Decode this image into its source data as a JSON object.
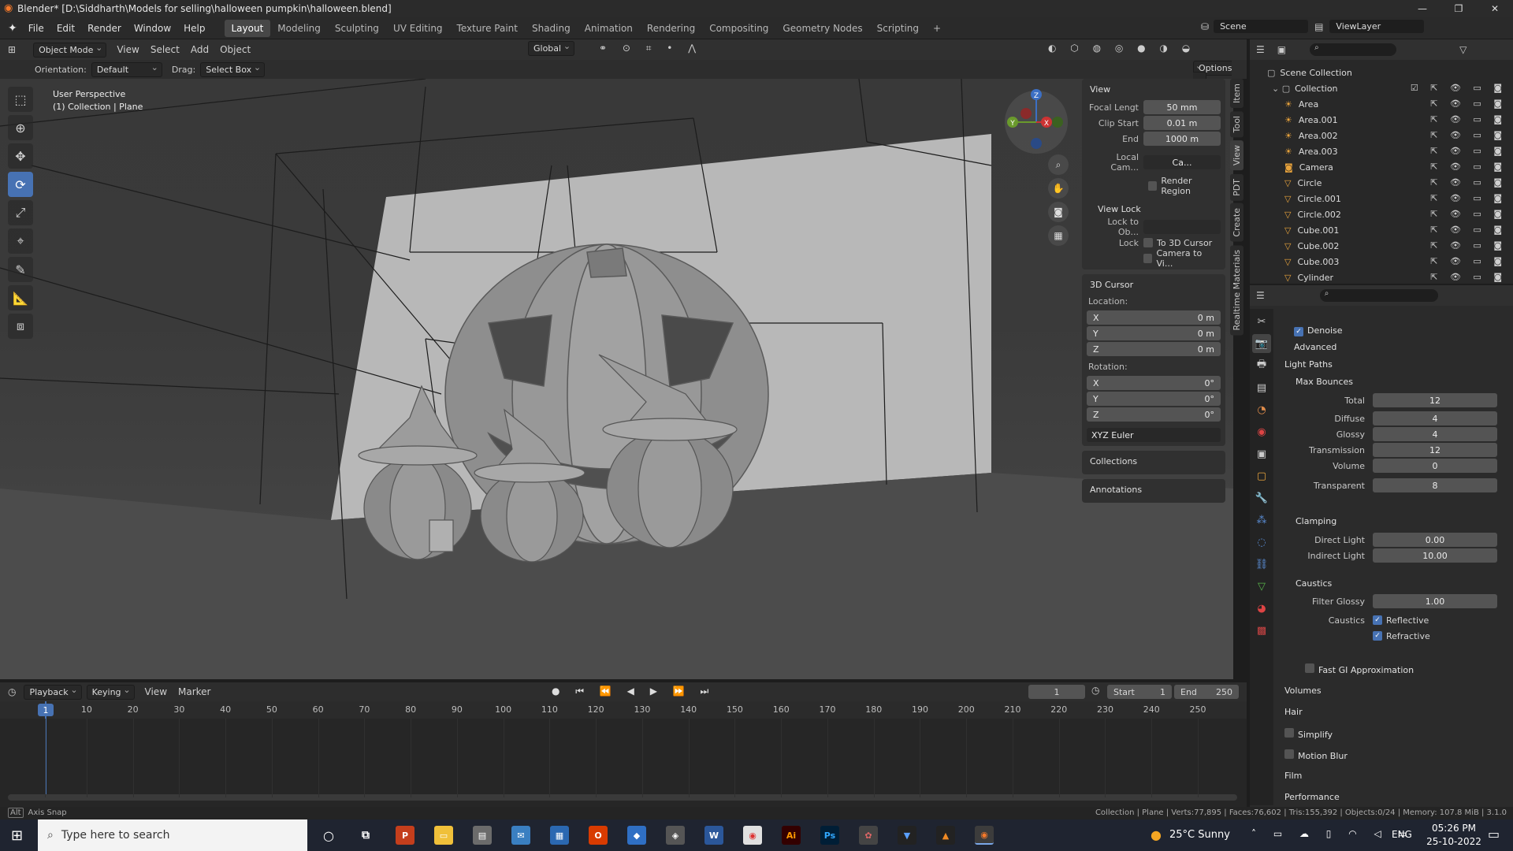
{
  "window": {
    "title": "Blender* [D:\\Siddharth\\Models for selling\\halloween pumpkin\\halloween.blend]",
    "minimize": "—",
    "maximize": "❐",
    "close": "✕"
  },
  "menu": [
    "File",
    "Edit",
    "Render",
    "Window",
    "Help"
  ],
  "workspaces": [
    "Layout",
    "Modeling",
    "Sculpting",
    "UV Editing",
    "Texture Paint",
    "Shading",
    "Animation",
    "Rendering",
    "Compositing",
    "Geometry Nodes",
    "Scripting"
  ],
  "active_workspace": "Layout",
  "scene": {
    "scene_name": "Scene",
    "view_layer": "ViewLayer"
  },
  "viewport_header": {
    "mode": "Object Mode",
    "menus": [
      "View",
      "Select",
      "Add",
      "Object"
    ],
    "transform": "Global",
    "options": "Options"
  },
  "tool_settings": {
    "orientation_label": "Orientation:",
    "orientation_value": "Default",
    "drag_label": "Drag:",
    "drag_value": "Select Box"
  },
  "viewport_info": {
    "line1": "User Perspective",
    "line2": "(1) Collection | Plane"
  },
  "npanel": {
    "view_title": "View",
    "focal_label": "Focal Lengt",
    "focal_value": "50 mm",
    "clip_start_label": "Clip Start",
    "clip_start_value": "0.01 m",
    "end_label": "End",
    "end_value": "1000 m",
    "local_cam_label": "Local Cam...",
    "local_cam_value": "Ca...",
    "render_region": "Render Region",
    "view_lock_title": "View Lock",
    "lock_to_obj_label": "Lock to Ob...",
    "lock_label": "Lock",
    "to_3d_cursor": "To 3D Cursor",
    "camera_to_view": "Camera to Vi...",
    "cursor_title": "3D Cursor",
    "location_label": "Location:",
    "loc_x": "0 m",
    "loc_y": "0 m",
    "loc_z": "0 m",
    "rotation_label": "Rotation:",
    "rot_x": "0°",
    "rot_y": "0°",
    "rot_z": "0°",
    "rot_mode": "XYZ Euler",
    "collections": "Collections",
    "annotations": "Annotations",
    "axis_x": "X",
    "axis_y": "Y",
    "axis_z": "Z",
    "tabs": [
      "Item",
      "Tool",
      "View",
      "PDT",
      "Create",
      "Realtime Materials"
    ]
  },
  "outliner": {
    "root": "Scene Collection",
    "collection": "Collection",
    "items": [
      "Area",
      "Area.001",
      "Area.002",
      "Area.003",
      "Camera",
      "Circle",
      "Circle.001",
      "Circle.002",
      "Cube.001",
      "Cube.002",
      "Cube.003",
      "Cylinder"
    ]
  },
  "properties": {
    "denoise": "Denoise",
    "advanced": "Advanced",
    "light_paths": "Light Paths",
    "max_bounces": "Max Bounces",
    "total_label": "Total",
    "total": "12",
    "diffuse_label": "Diffuse",
    "diffuse": "4",
    "glossy_label": "Glossy",
    "glossy": "4",
    "transmission_label": "Transmission",
    "transmission": "12",
    "volume_label": "Volume",
    "volume": "0",
    "transparent_label": "Transparent",
    "transparent": "8",
    "clamping": "Clamping",
    "direct_label": "Direct Light",
    "direct": "0.00",
    "indirect_label": "Indirect Light",
    "indirect": "10.00",
    "caustics": "Caustics",
    "filter_glossy_label": "Filter Glossy",
    "filter_glossy": "1.00",
    "caustics_label": "Caustics",
    "reflective": "Reflective",
    "refractive": "Refractive",
    "fast_gi": "Fast GI Approximation",
    "volumes": "Volumes",
    "hair": "Hair",
    "simplify": "Simplify",
    "motion_blur": "Motion Blur",
    "film": "Film",
    "performance": "Performance"
  },
  "timeline": {
    "menus": [
      "Playback",
      "Keying",
      "View",
      "Marker"
    ],
    "current_frame": "1",
    "start_label": "Start",
    "start": "1",
    "end_label": "End",
    "end": "250",
    "ruler": [
      "1",
      "10",
      "20",
      "30",
      "40",
      "50",
      "60",
      "70",
      "80",
      "90",
      "100",
      "110",
      "120",
      "130",
      "140",
      "150",
      "160",
      "170",
      "180",
      "190",
      "200",
      "210",
      "220",
      "230",
      "240",
      "250"
    ]
  },
  "status": {
    "left": "Axis Snap",
    "right": "Collection | Plane | Verts:77,895 | Faces:76,602 | Tris:155,392 | Objects:0/24 | Memory: 107.8 MiB | 3.1.0"
  },
  "taskbar": {
    "search_placeholder": "Type here to search",
    "weather": "25°C  Sunny",
    "lang": "ENG",
    "time": "05:26 PM",
    "date": "25-10-2022"
  },
  "colors": {
    "accent": "#4772b3",
    "bg": "#393939",
    "panel": "#303030"
  }
}
